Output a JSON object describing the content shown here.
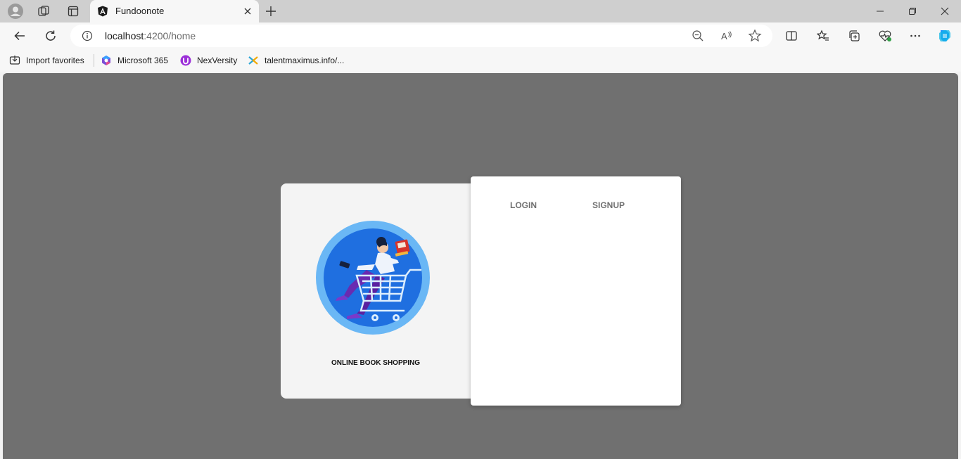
{
  "browser": {
    "tab_title": "Fundoonote",
    "url_host": "localhost",
    "url_path": ":4200/home"
  },
  "favorites": [
    {
      "label": "Import favorites",
      "icon": "import-favorites-icon"
    },
    {
      "label": "Microsoft 365",
      "icon": "microsoft-365-icon"
    },
    {
      "label": "NexVersity",
      "icon": "nexversity-icon"
    },
    {
      "label": "talentmaximus.info/...",
      "icon": "talentmaximus-icon"
    }
  ],
  "app": {
    "caption": "ONLINE BOOK SHOPPING",
    "login_label": "LOGIN",
    "signup_label": "SIGNUP"
  },
  "colors": {
    "page_background": "#707070",
    "card_left": "#f4f4f4",
    "card_right": "#ffffff",
    "illustration_outer": "#6ab7f5",
    "illustration_inner": "#1f6fe0",
    "accent_purple": "#6a2bb0"
  }
}
